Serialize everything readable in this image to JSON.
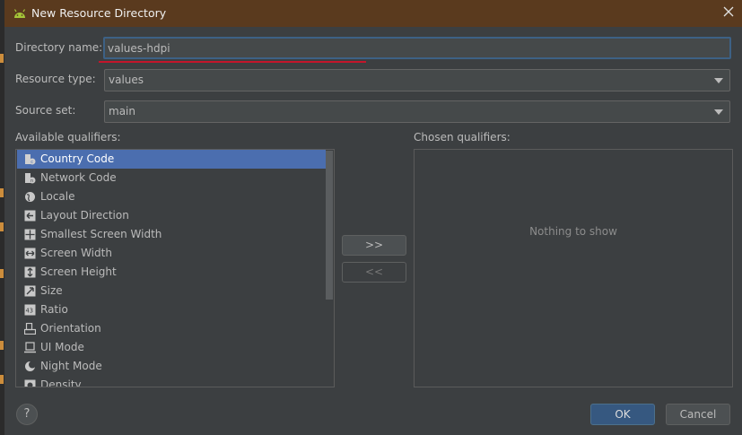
{
  "window": {
    "title": "New Resource Directory",
    "icon": "android-icon"
  },
  "form": {
    "directory_name_label": "Directory name:",
    "directory_name_value": "values-hdpi",
    "resource_type_label": "Resource type:",
    "resource_type_value": "values",
    "source_set_label": "Source set:",
    "source_set_value": "main"
  },
  "available": {
    "label": "Available qualifiers:",
    "items": [
      {
        "label": "Country Code",
        "icon": "country-code-icon",
        "selected": true
      },
      {
        "label": "Network Code",
        "icon": "network-code-icon"
      },
      {
        "label": "Locale",
        "icon": "globe-icon"
      },
      {
        "label": "Layout Direction",
        "icon": "layout-direction-icon"
      },
      {
        "label": "Smallest Screen Width",
        "icon": "smallest-width-icon"
      },
      {
        "label": "Screen Width",
        "icon": "screen-width-icon"
      },
      {
        "label": "Screen Height",
        "icon": "screen-height-icon"
      },
      {
        "label": "Size",
        "icon": "size-icon"
      },
      {
        "label": "Ratio",
        "icon": "ratio-icon"
      },
      {
        "label": "Orientation",
        "icon": "orientation-icon"
      },
      {
        "label": "UI Mode",
        "icon": "ui-mode-icon"
      },
      {
        "label": "Night Mode",
        "icon": "night-mode-icon"
      },
      {
        "label": "Density",
        "icon": "density-icon"
      }
    ]
  },
  "chosen": {
    "label": "Chosen qualifiers:",
    "empty_text": "Nothing to show"
  },
  "buttons": {
    "add": ">>",
    "remove": "<<",
    "ok": "OK",
    "cancel": "Cancel",
    "help": "?"
  },
  "colors": {
    "background": "#3c3f41",
    "selection": "#4b6eaf",
    "primary": "#365880",
    "error_underline": "#c4152b"
  }
}
